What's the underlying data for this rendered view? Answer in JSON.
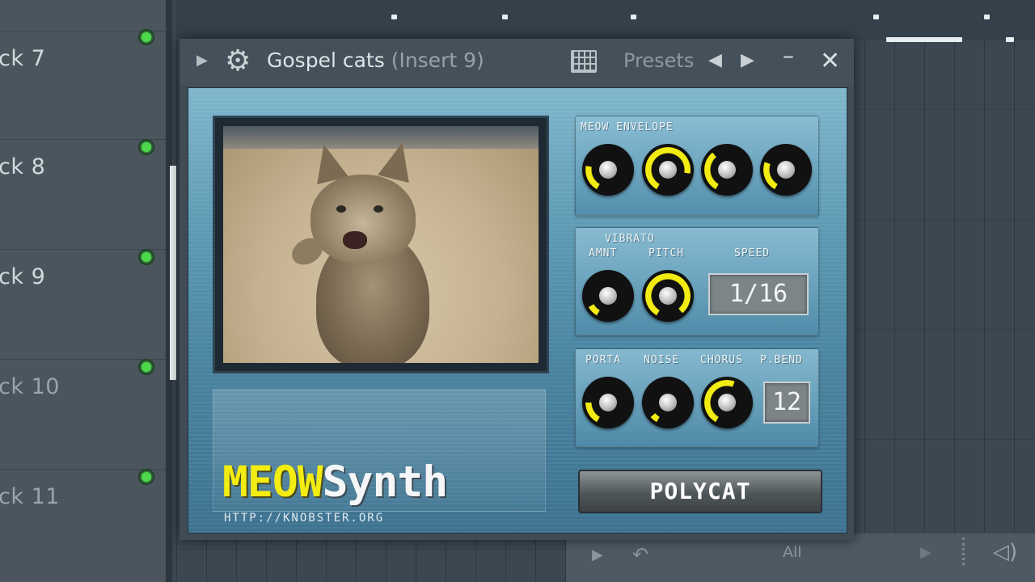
{
  "tracks": [
    {
      "label": "ck 7"
    },
    {
      "label": "ck 8"
    },
    {
      "label": "ck 9"
    },
    {
      "label": "ck 10"
    },
    {
      "label": "ck 11"
    }
  ],
  "plugin": {
    "title": "Gospel cats",
    "insert": "(Insert 9)",
    "presets_label": "Presets"
  },
  "synth": {
    "name_part1": "MEOW",
    "name_part2": "Synth",
    "url": "HTTP://KNOBSTER.ORG",
    "panels": {
      "envelope": {
        "label": "MEOW ENVELOPE"
      },
      "vibrato": {
        "group_label": "VIBRATO",
        "amnt_label": "AMNT",
        "pitch_label": "PITCH",
        "speed_label": "SPEED",
        "speed_value": "1/16"
      },
      "misc": {
        "porta_label": "PORTA",
        "noise_label": "NOISE",
        "chorus_label": "CHORUS",
        "pbend_label": "P.BEND",
        "pbend_value": "12"
      }
    },
    "polycat_label": "POLYCAT"
  },
  "bottom_bar": {
    "filter_label": "All"
  },
  "colors": {
    "knob_accent": "#f3ec12",
    "led_green": "#4cd84a",
    "logo_yellow": "#f3ec12"
  }
}
